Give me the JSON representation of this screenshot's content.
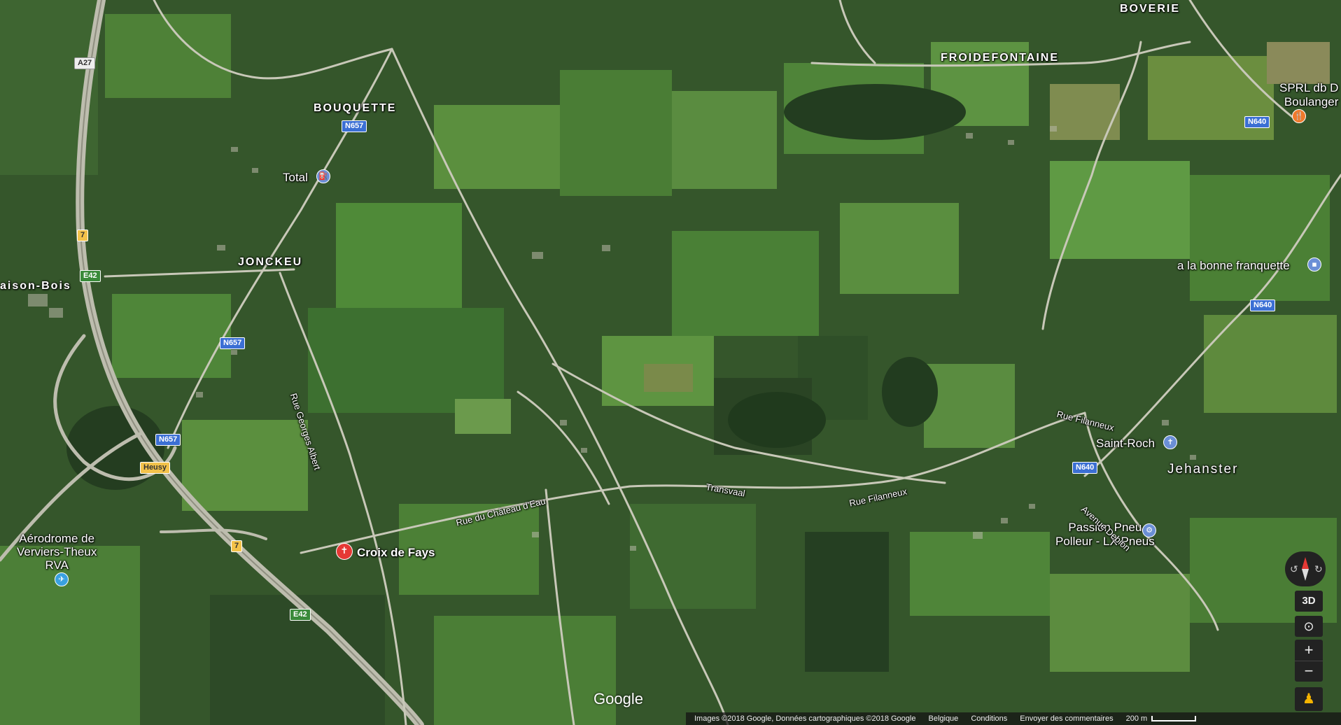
{
  "places": {
    "boverie": "BOVERIE",
    "froidefontaine": "FROIDEFONTAINE",
    "bouquette": "BOUQUETTE",
    "jonckeu": "JONCKEU",
    "maison_bois": "aison-Bois",
    "jehanster": "Jehanster"
  },
  "pois": {
    "sprl_line1": "SPRL db D",
    "sprl_line2": "Boulanger",
    "total": "Total",
    "bonne_franquette": "a la bonne franquette",
    "saint_roch": "Saint-Roch",
    "passion_line1": "Passion Pneu",
    "passion_line2": "Polleur - LX Pneus",
    "croix": "Croix de Fays",
    "aero_line1": "Aérodrome de",
    "aero_line2": "Verviers-Theux",
    "aero_line3": "RVA"
  },
  "streets": {
    "georges_albert": "Rue Georges Albert",
    "chateau_eau": "Rue du Château d'Eau",
    "transvaal": "Transvaal",
    "filanneux1": "Rue Filanneux",
    "filanneux2": "Rue Filanneux",
    "debion": "Avenue Debion"
  },
  "shields": {
    "a27": "A27",
    "n657_1": "N657",
    "n657_2": "N657",
    "n657_3": "N657",
    "n640_1": "N640",
    "n640_2": "N640",
    "n640_3": "N640",
    "e42_1": "E42",
    "e42_2": "E42",
    "s7_1": "7",
    "s7_2": "7",
    "heusy": "Heusy"
  },
  "controls": {
    "three_d": "3D",
    "zoom_in": "+",
    "zoom_out": "−"
  },
  "google_logo": "Google",
  "footer": {
    "imagery": "Images ©2018 Google, Données cartographiques ©2018 Google",
    "country": "Belgique",
    "conditions": "Conditions",
    "feedback": "Envoyer des commentaires",
    "scale": "200 m"
  },
  "colors": {
    "field_dark": "#2f4d27",
    "field_mid": "#4a7a34",
    "field_light": "#6f9a4a",
    "road": "#c8c8b8",
    "highway": "#bdbdae"
  }
}
